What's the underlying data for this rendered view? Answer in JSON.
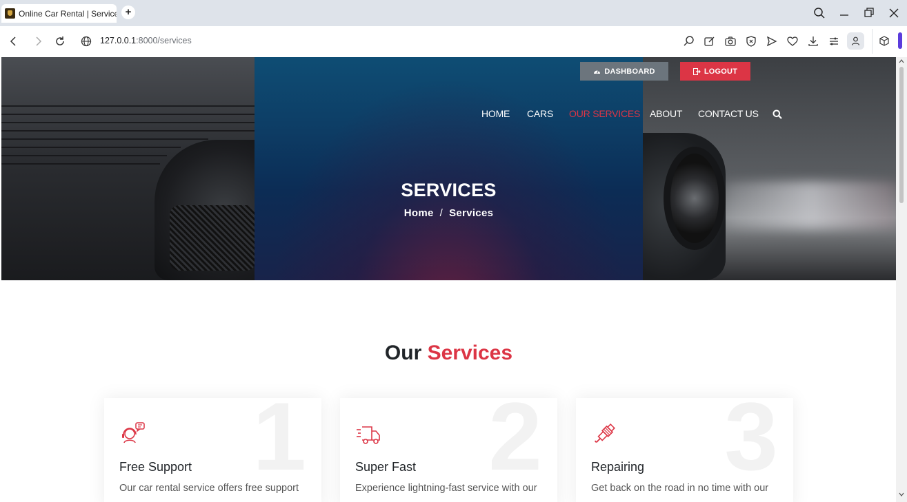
{
  "browser": {
    "tab_title": "Online Car Rental | Services",
    "new_tab_symbol": "+",
    "url_host": "127.0.0.1",
    "url_rest": ":8000/services"
  },
  "header": {
    "dashboard_label": "DASHBOARD",
    "logout_label": "LOGOUT",
    "nav": {
      "home": "HOME",
      "cars": "CARS",
      "services": "OUR SERVICES",
      "about": "ABOUT",
      "contact": "CONTACT US"
    }
  },
  "hero": {
    "title": "SERVICES",
    "breadcrumb_home": "Home",
    "breadcrumb_sep": "/",
    "breadcrumb_current": "Services"
  },
  "services": {
    "title_prefix": "Our",
    "title_accent": "Services",
    "cards": [
      {
        "number": "1",
        "title": "Free Support",
        "text": "Our car rental service offers free support",
        "icon": "support-agent-icon"
      },
      {
        "number": "2",
        "title": "Super Fast",
        "text": "Experience lightning-fast service with our",
        "icon": "delivery-truck-icon"
      },
      {
        "number": "3",
        "title": "Repairing",
        "text": "Get back on the road in no time with our",
        "icon": "spark-plug-icon"
      }
    ]
  },
  "colors": {
    "accent": "#dc3545",
    "dashboard_button": "#6c757d",
    "hero_overlay": "#0d3e66"
  }
}
